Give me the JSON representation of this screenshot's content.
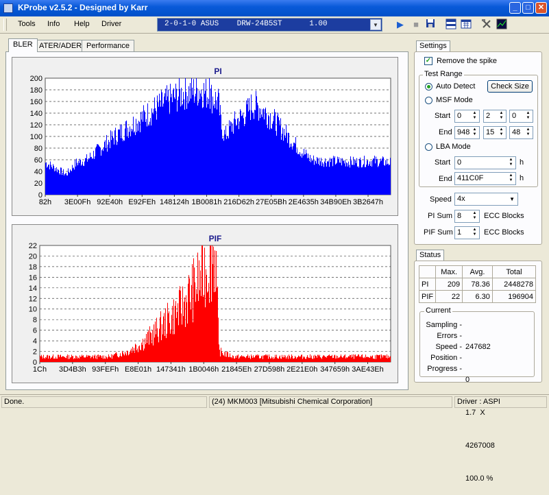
{
  "window": {
    "title": "KProbe v2.5.2 - Designed by Karr",
    "min": "_",
    "max": "□",
    "close": "✕"
  },
  "menu": [
    "Tools",
    "Info",
    "Help",
    "Driver"
  ],
  "drive": {
    "selected": "2-0-1-0 ASUS    DRW-24B5ST      1.00"
  },
  "toolbar": {
    "icons": [
      "play-icon",
      "stop-icon",
      "save-icon",
      "layout-icon",
      "calendar-icon",
      "tools-icon",
      "chart-icon"
    ]
  },
  "tabs": [
    "BLER",
    "ATER/ADER",
    "Performance"
  ],
  "colors": {
    "pi": "#0000ff",
    "pif": "#ff0000",
    "title": "#1a1a8c"
  },
  "chart_data": [
    {
      "type": "area",
      "title": "PI",
      "ylim": [
        0,
        200
      ],
      "yticks": [
        0,
        20,
        40,
        60,
        80,
        100,
        120,
        140,
        160,
        180,
        200
      ],
      "xticks": [
        "82h",
        "3E00Fh",
        "92E40h",
        "E92FEh",
        "148124h",
        "1B0081h",
        "216D62h",
        "27E05Bh",
        "2E4635h",
        "34B90Eh",
        "3B2647h"
      ],
      "x": [
        0,
        0.03,
        0.06,
        0.09,
        0.12,
        0.16,
        0.2,
        0.25,
        0.3,
        0.35,
        0.4,
        0.45,
        0.5,
        0.51,
        0.52,
        0.53,
        0.55,
        0.58,
        0.6,
        0.62,
        0.65,
        0.68,
        0.71,
        0.74,
        0.77,
        0.8,
        0.85,
        0.9,
        0.95,
        1.0
      ],
      "values": [
        55,
        45,
        35,
        55,
        60,
        80,
        100,
        120,
        140,
        160,
        175,
        180,
        160,
        115,
        100,
        110,
        125,
        140,
        155,
        150,
        135,
        115,
        95,
        75,
        60,
        58,
        57,
        56,
        58,
        55
      ],
      "peak": {
        "x": 0.475,
        "value": 209
      }
    },
    {
      "type": "area",
      "title": "PIF",
      "ylim": [
        0,
        22
      ],
      "yticks": [
        0,
        2,
        4,
        6,
        8,
        10,
        12,
        14,
        16,
        18,
        20,
        22
      ],
      "xticks": [
        "1Ch",
        "3D4B3h",
        "93FEFh",
        "E8E01h",
        "147341h",
        "1B0046h",
        "21845Eh",
        "27D598h",
        "2E21E0h",
        "347659h",
        "3AE43Eh"
      ],
      "x": [
        0,
        0.05,
        0.1,
        0.15,
        0.2,
        0.25,
        0.3,
        0.35,
        0.4,
        0.43,
        0.46,
        0.48,
        0.5,
        0.51,
        0.55,
        0.6,
        0.7,
        0.8,
        0.9,
        1.0
      ],
      "values": [
        1,
        1,
        1,
        1,
        1,
        2,
        4,
        7,
        10,
        13,
        16,
        19,
        21,
        2,
        1,
        1,
        1,
        1,
        1,
        1
      ],
      "peak": {
        "x": 0.49,
        "value": 22
      }
    }
  ],
  "settings": {
    "tab": "Settings",
    "remove_spike": "Remove the spike",
    "test_range": "Test Range",
    "auto_detect": "Auto Detect",
    "check_size": "Check Size",
    "msf_mode": "MSF Mode",
    "start_label": "Start",
    "start": [
      "0",
      "2",
      "0"
    ],
    "end_label": "End",
    "end": [
      "948",
      "15",
      "48"
    ],
    "lba_mode": "LBA Mode",
    "lba_start": "0",
    "lba_end": "411C0F",
    "h": "h",
    "speed_label": "Speed",
    "speed": "4x",
    "pi_sum_label": "PI Sum",
    "pi_sum": "8",
    "pif_sum_label": "PIF Sum",
    "pif_sum": "1",
    "ecc": "ECC Blocks"
  },
  "status": {
    "tab": "Status",
    "headers": [
      "",
      "Max.",
      "Avg.",
      "Total"
    ],
    "rows": [
      [
        "PI",
        "209",
        "78.36",
        "2448278"
      ],
      [
        "PIF",
        "22",
        "6.30",
        "196904"
      ]
    ],
    "current": "Current",
    "labels": [
      "Sampling -",
      "Errors -",
      "Speed -",
      "Position -",
      "Progress -"
    ],
    "values": [
      "247682",
      "0",
      "1.7  X",
      "4267008",
      "100.0 %"
    ]
  },
  "statusbar": {
    "left": "Done.",
    "middle": "(24) MKM003 [Mitsubishi Chemical Corporation]",
    "right": "Driver : ASPI"
  }
}
